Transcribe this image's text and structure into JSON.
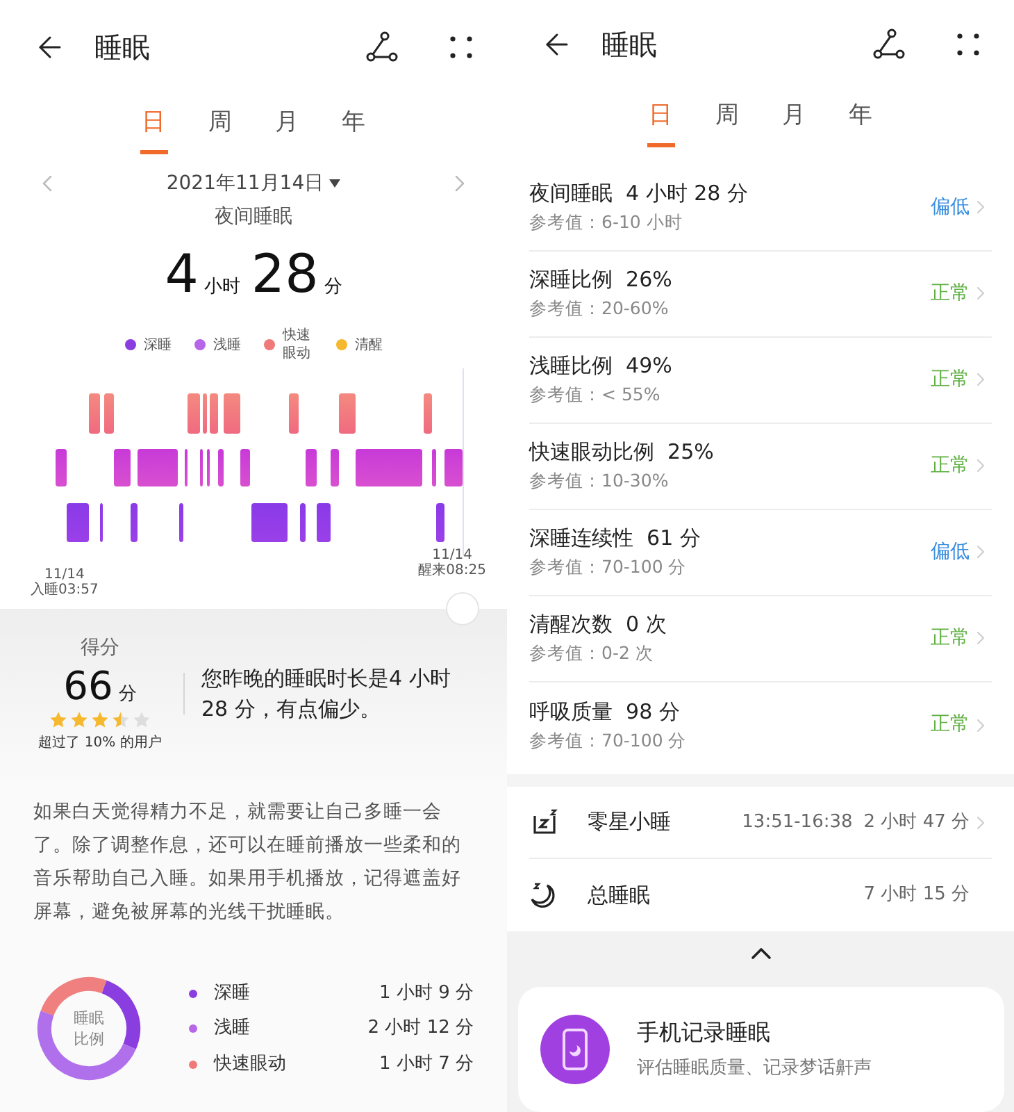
{
  "left": {
    "header": {
      "title": "睡眠"
    },
    "tabs": [
      {
        "label": "日",
        "selected": true
      },
      {
        "label": "周",
        "selected": false
      },
      {
        "label": "月",
        "selected": false
      },
      {
        "label": "年",
        "selected": false
      }
    ],
    "date": "2021年11月14日",
    "section_title": "夜间睡眠",
    "duration": {
      "hours": "4",
      "hours_unit": "小时",
      "minutes": "28",
      "minutes_unit": "分"
    },
    "legend": [
      {
        "label": "深睡",
        "color": "#8a3ee0"
      },
      {
        "label": "浅睡",
        "color": "#b866e8"
      },
      {
        "label": "快速眼动",
        "color": "#f07a7a"
      },
      {
        "label": "清醒",
        "color": "#f5b82e"
      }
    ],
    "chart_labels": {
      "start_date": "11/14",
      "start": "入睡03:57",
      "end_date": "11/14",
      "end": "醒来08:25"
    },
    "score": {
      "label": "得分",
      "value": "66",
      "unit": "分",
      "stars": 3.5,
      "percentile": "超过了 10% 的用户",
      "summary": "您昨晚的睡眠时长是4 小时 28 分，有点偏少。"
    },
    "advice": "如果白天觉得精力不足，就需要让自己多睡一会了。除了调整作息，还可以在睡前播放一些柔和的音乐帮助自己入睡。如果用手机播放，记得遮盖好屏幕，避免被屏幕的光线干扰睡眠。",
    "ratio": {
      "center": "睡眠比例",
      "items": [
        {
          "label": "深睡",
          "color": "#8a3ee0",
          "value": "1 小时 9 分"
        },
        {
          "label": "浅睡",
          "color": "#b866e8",
          "value": "2 小时 12 分"
        },
        {
          "label": "快速眼动",
          "color": "#f07a7a",
          "value": "1 小时 7 分"
        }
      ]
    }
  },
  "right": {
    "header": {
      "title": "睡眠"
    },
    "tabs": [
      {
        "label": "日",
        "selected": true
      },
      {
        "label": "周",
        "selected": false
      },
      {
        "label": "月",
        "selected": false
      },
      {
        "label": "年",
        "selected": false
      }
    ],
    "metrics": [
      {
        "title": "夜间睡眠  4 小时 28 分",
        "reference": "参考值：6-10 小时",
        "status": "偏低",
        "color": "#3a8ee0"
      },
      {
        "title": "深睡比例  26%",
        "reference": "参考值：20-60%",
        "status": "正常",
        "color": "#5fb043"
      },
      {
        "title": "浅睡比例  49%",
        "reference": "参考值：< 55%",
        "status": "正常",
        "color": "#5fb043"
      },
      {
        "title": "快速眼动比例  25%",
        "reference": "参考值：10-30%",
        "status": "正常",
        "color": "#5fb043"
      },
      {
        "title": "深睡连续性  61 分",
        "reference": "参考值：70-100 分",
        "status": "偏低",
        "color": "#3a8ee0"
      },
      {
        "title": "清醒次数  0 次",
        "reference": "参考值：0-2 次",
        "status": "正常",
        "color": "#5fb043"
      },
      {
        "title": "呼吸质量  98 分",
        "reference": "参考值：70-100 分",
        "status": "正常",
        "color": "#5fb043"
      }
    ],
    "extras": [
      {
        "kind": "nap",
        "label": "零星小睡",
        "time": "13:51-16:38",
        "value": "2 小时 47 分",
        "link": true
      },
      {
        "kind": "total",
        "label": "总睡眠",
        "value": "7 小时 15 分",
        "link": false
      }
    ],
    "promo": {
      "title": "手机记录睡眠",
      "subtitle": "评估睡眠质量、记录梦话鼾声"
    }
  }
}
